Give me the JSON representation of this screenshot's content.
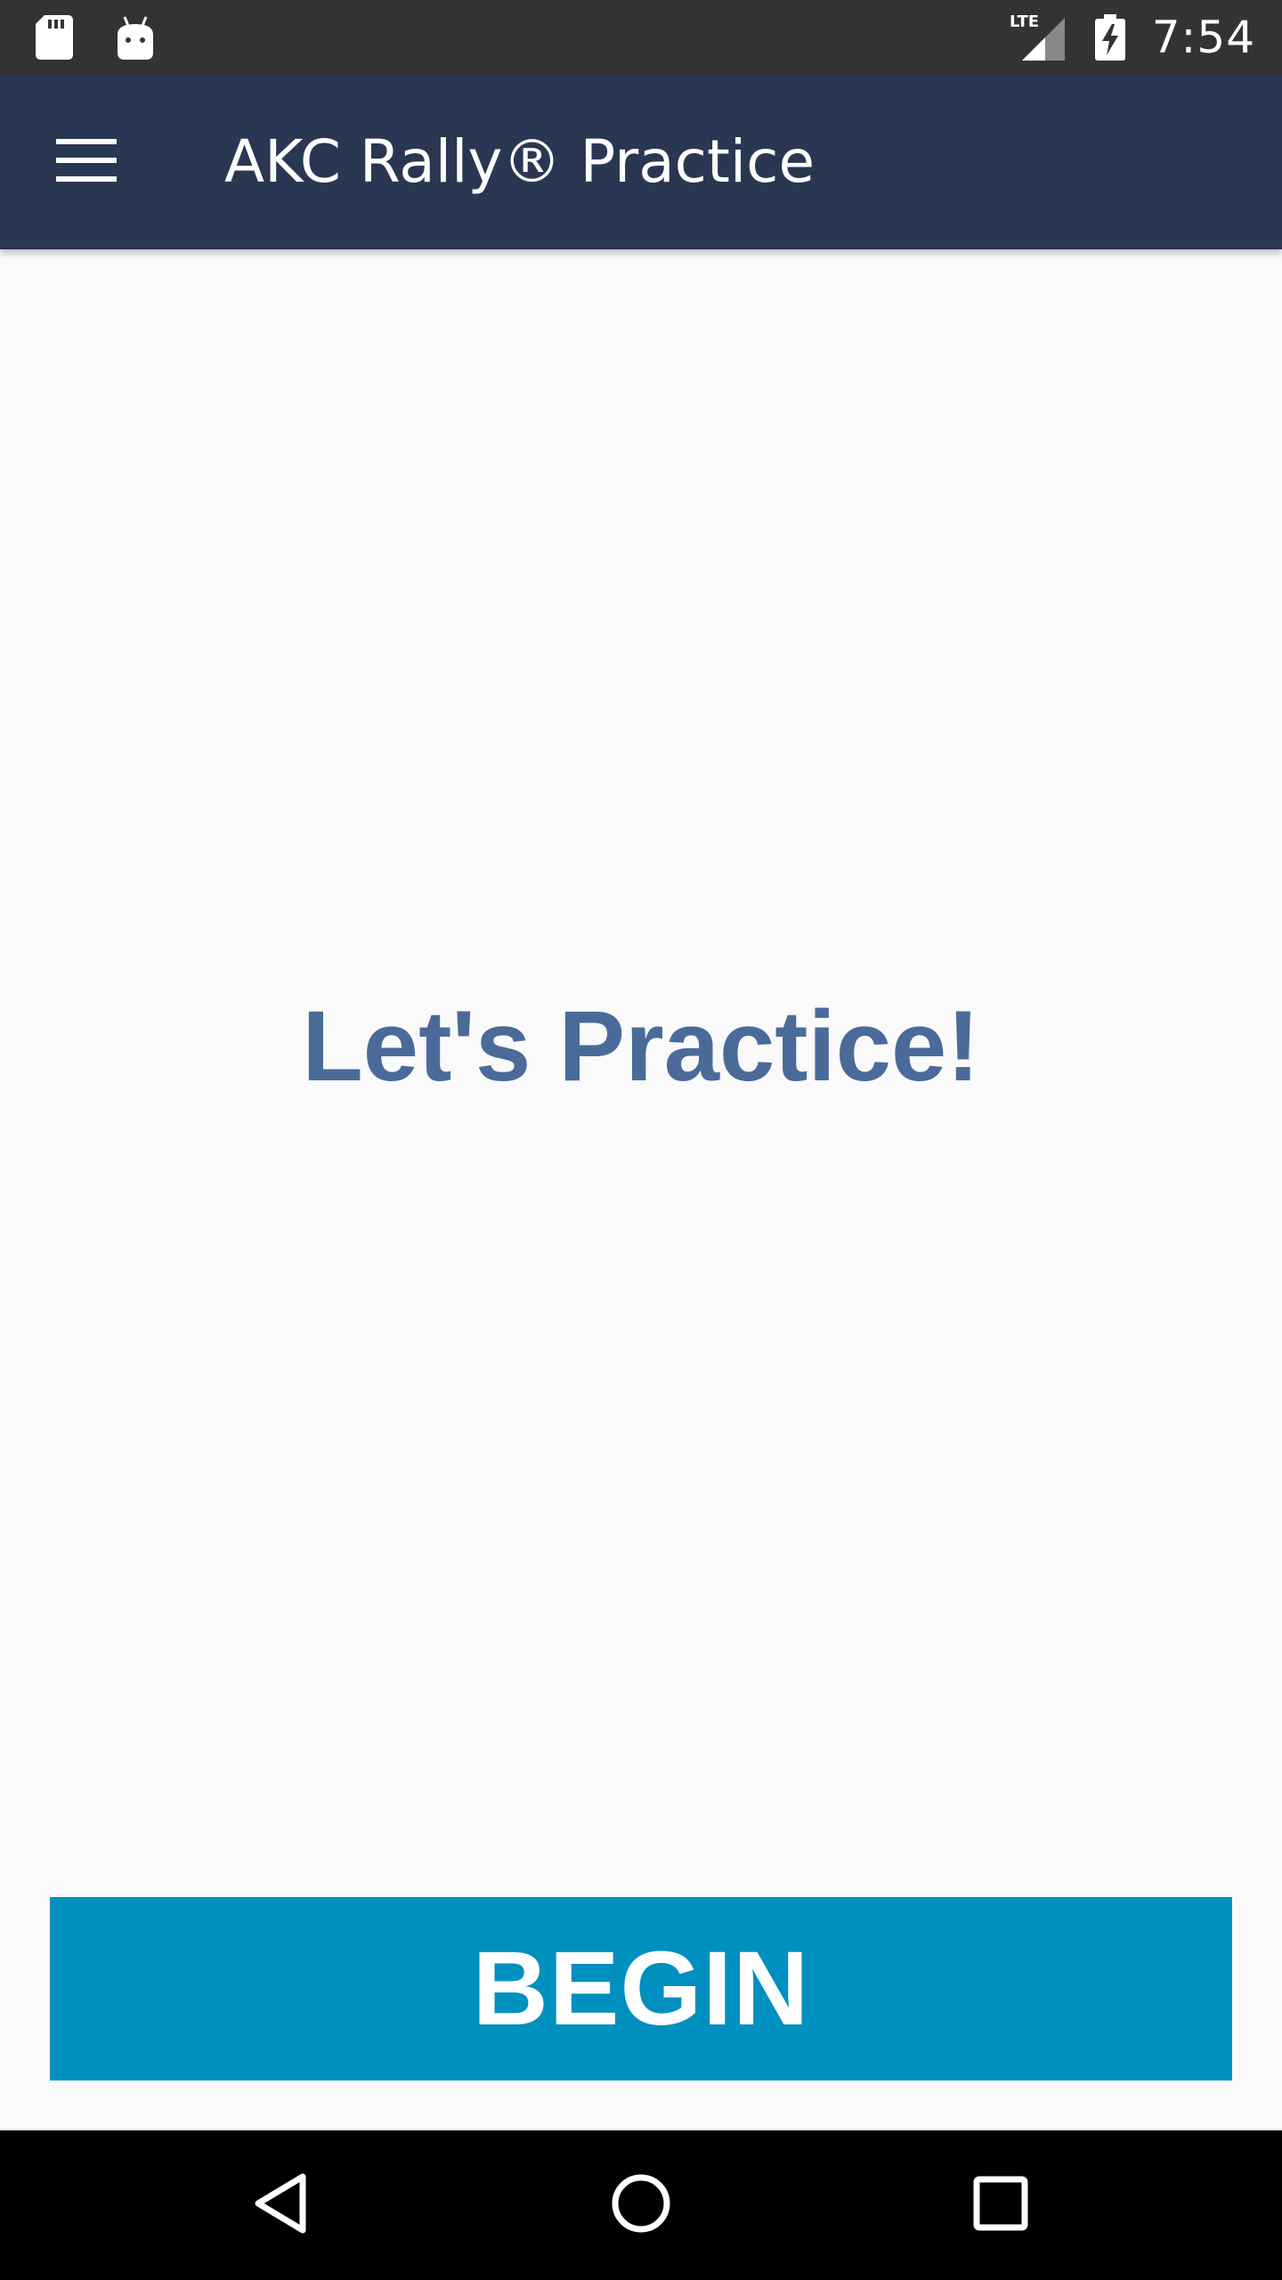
{
  "status_bar": {
    "left_icons": [
      "sd-card-icon",
      "android-icon"
    ],
    "network_label": "LTE",
    "right_icons": [
      "signal-icon",
      "battery-charging-icon"
    ],
    "time": "7:54"
  },
  "app_bar": {
    "menu_icon": "hamburger-menu-icon",
    "title": "AKC Rally® Practice"
  },
  "main": {
    "headline": "Let's Practice!",
    "begin_label": "BEGIN"
  },
  "nav_bar": {
    "buttons": [
      "back-icon",
      "home-icon",
      "recents-icon"
    ]
  },
  "colors": {
    "status_bar": "#333333",
    "app_bar": "#2a3752",
    "background": "#fafafa",
    "headline": "#4a6b9a",
    "begin_button": "#0090bf",
    "nav_bar": "#000000"
  }
}
